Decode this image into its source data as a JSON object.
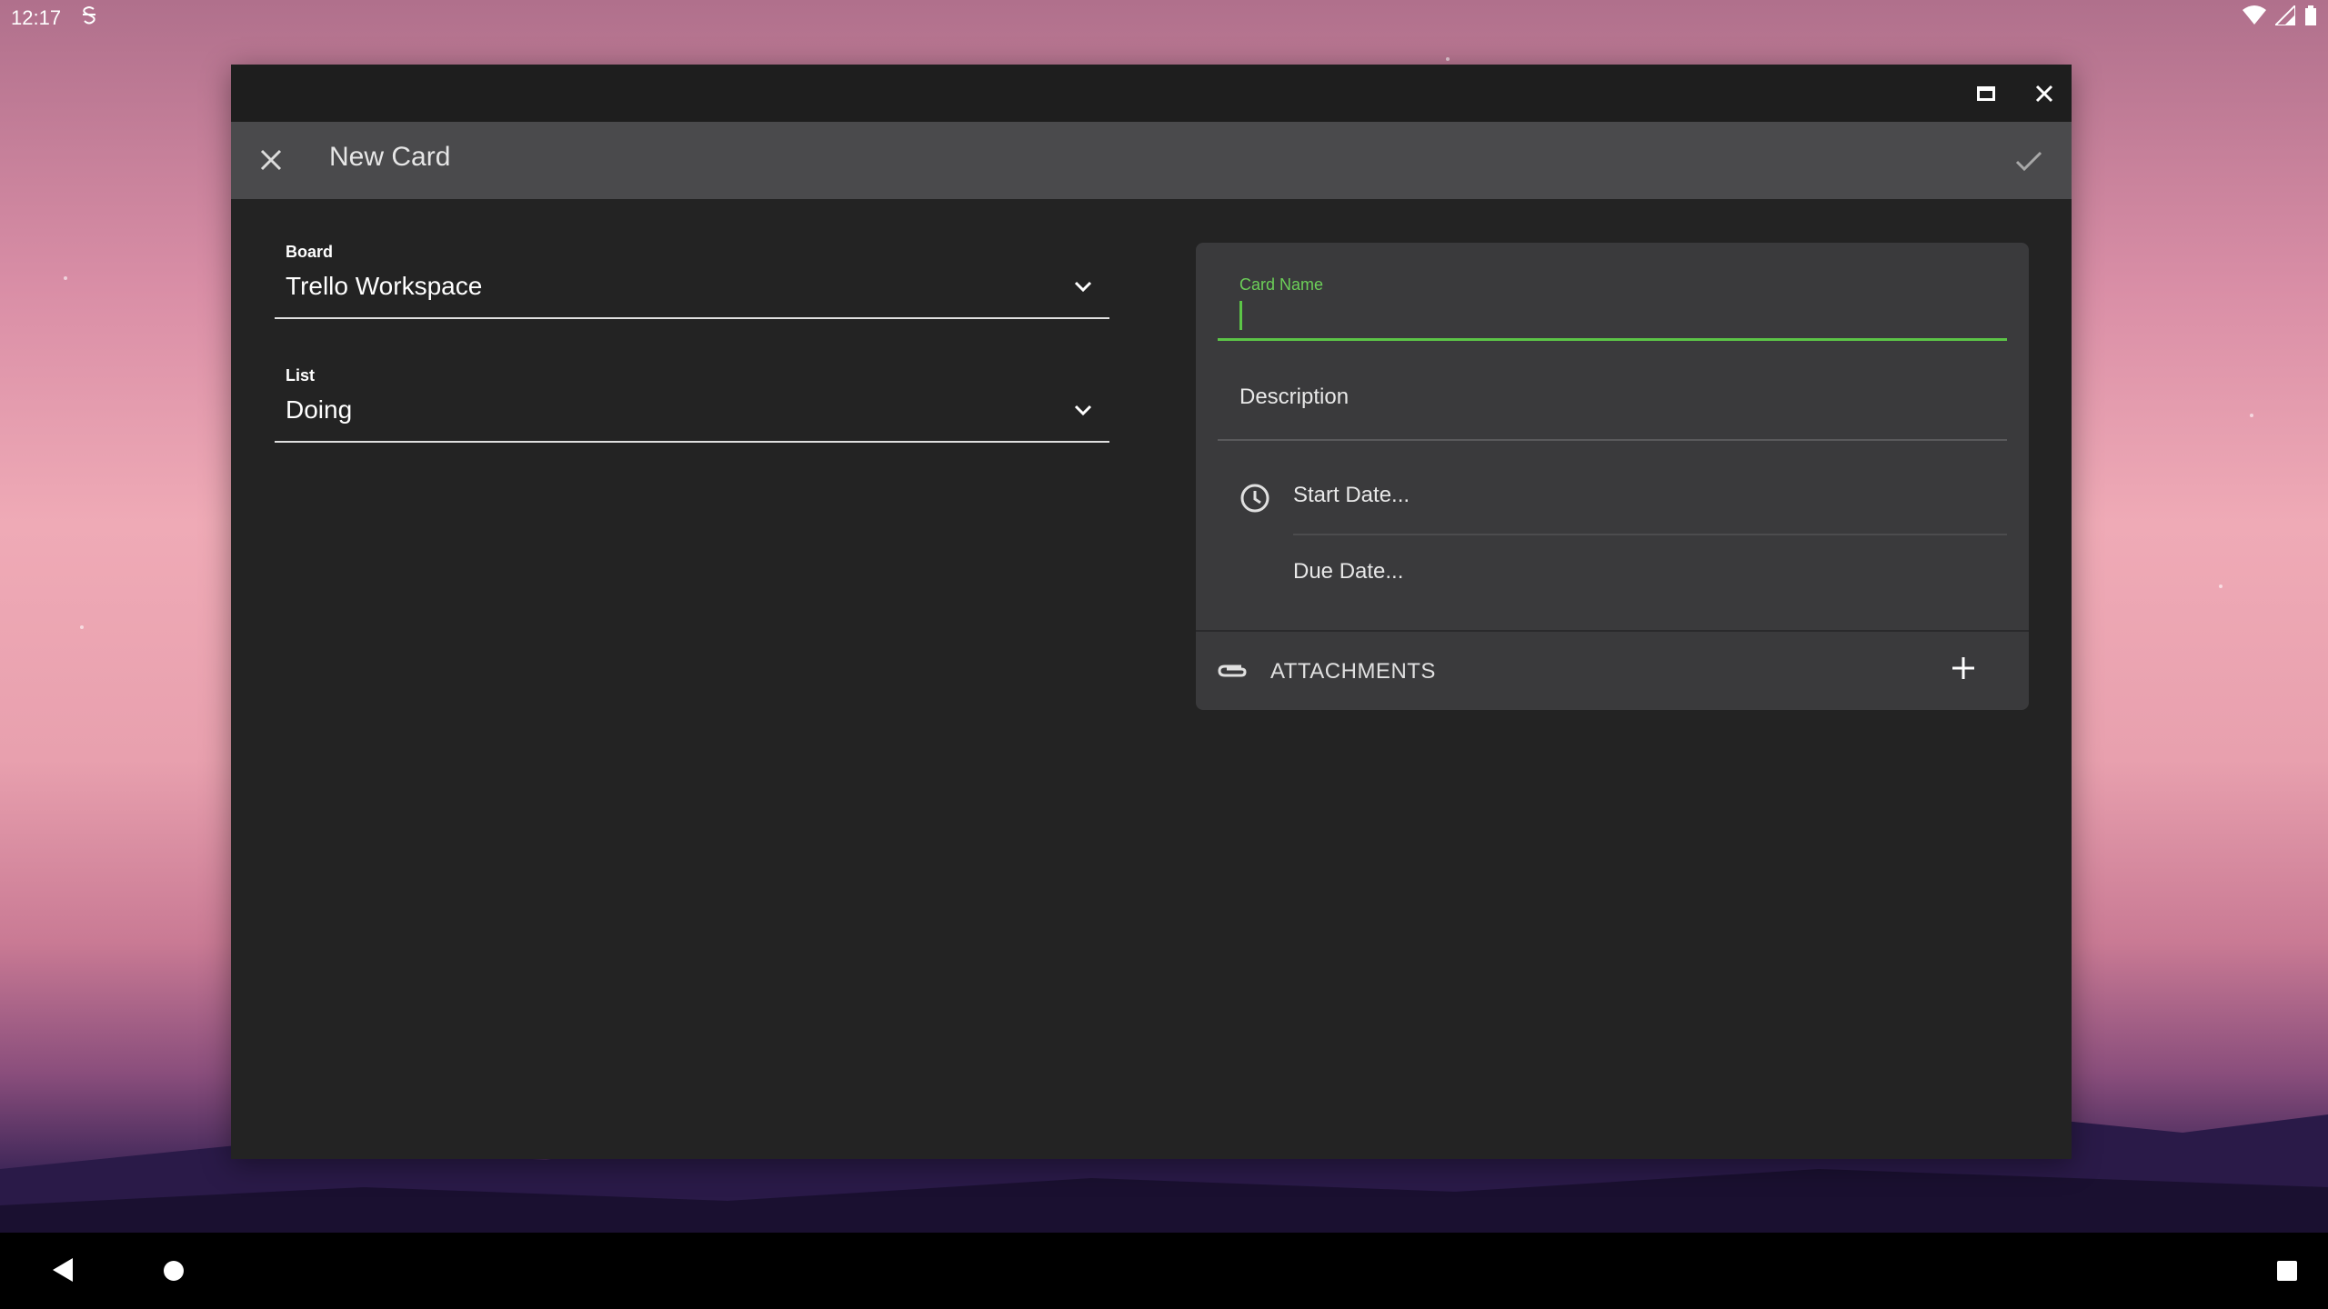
{
  "status_bar": {
    "time": "12:17",
    "notification_icon": "s-icon",
    "right_icons": [
      "wifi-icon",
      "signal-icon",
      "battery-icon"
    ]
  },
  "window": {
    "caption_buttons": [
      "maximize-icon",
      "close-icon"
    ]
  },
  "app_bar": {
    "title": "New Card",
    "close_icon": "close-icon",
    "confirm_icon": "check-icon"
  },
  "form": {
    "board": {
      "label": "Board",
      "value": "Trello Workspace"
    },
    "list": {
      "label": "List",
      "value": "Doing"
    }
  },
  "card": {
    "name_label": "Card Name",
    "name_value": "",
    "description_placeholder": "Description",
    "start_date_placeholder": "Start Date...",
    "due_date_placeholder": "Due Date...",
    "attachments_label": "ATTACHMENTS"
  },
  "colors": {
    "accent": "#5cc547",
    "window_bg": "#232323",
    "app_bar_bg": "#4a4a4c",
    "panel_bg": "#3a3a3c"
  }
}
